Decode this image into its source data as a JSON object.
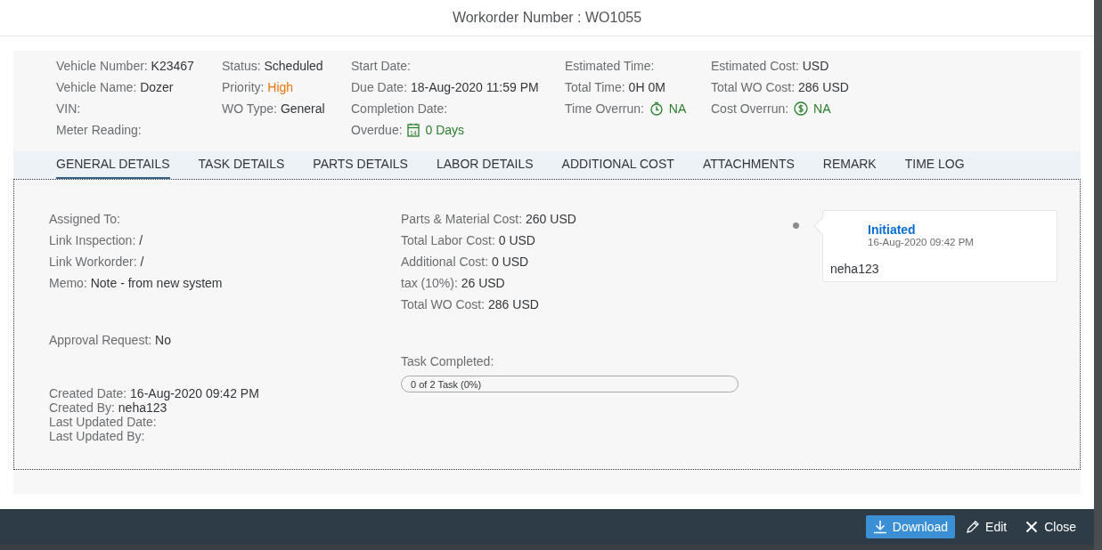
{
  "dialog": {
    "title": "Workorder Number : WO1055"
  },
  "header_columns": [
    {
      "fields": [
        {
          "label": "Vehicle Number:",
          "value": "K23467",
          "kind": "plain"
        },
        {
          "label": "Vehicle Name:",
          "value": "Dozer",
          "kind": "plain"
        },
        {
          "label": "VIN:",
          "kind": "plain"
        },
        {
          "label": "Meter Reading:",
          "kind": "plain"
        }
      ]
    },
    {
      "fields": [
        {
          "label": "Status:",
          "value": "Scheduled",
          "kind": "plain"
        },
        {
          "label": "Priority:",
          "value": "High",
          "kind": "plain",
          "color": "#e9730c"
        },
        {
          "label": "WO Type:",
          "value": "General",
          "kind": "plain"
        }
      ]
    },
    {
      "fields": [
        {
          "label": "Start Date:",
          "kind": "plain"
        },
        {
          "label": "Due Date:",
          "value": "18-Aug-2020 11:59 PM",
          "kind": "plain"
        },
        {
          "label": "Completion Date:",
          "kind": "plain"
        },
        {
          "label": "Overdue:",
          "value": "0 Days",
          "kind": "calendar",
          "color": "#2b7d2b",
          "icon_text": "14"
        }
      ]
    },
    {
      "fields": [
        {
          "label": "Estimated Time:",
          "kind": "plain"
        },
        {
          "label": "Total Time:",
          "value": "0H 0M",
          "kind": "plain"
        },
        {
          "label": "Time Overrun:",
          "value": "NA",
          "kind": "stopwatch",
          "color": "#2b7d2b"
        }
      ]
    },
    {
      "fields": [
        {
          "label": "Estimated Cost:",
          "value": "USD",
          "kind": "plain"
        },
        {
          "label": "Total WO Cost:",
          "value": "286 USD",
          "kind": "plain"
        },
        {
          "label": "Cost Overrun:",
          "value": "NA",
          "kind": "coin",
          "color": "#2b7d2b"
        }
      ]
    }
  ],
  "tabs": [
    {
      "label": "GENERAL DETAILS",
      "selected": true
    },
    {
      "label": "TASK DETAILS",
      "selected": false
    },
    {
      "label": "PARTS DETAILS",
      "selected": false
    },
    {
      "label": "LABOR DETAILS",
      "selected": false
    },
    {
      "label": "ADDITIONAL COST",
      "selected": false
    },
    {
      "label": "ATTACHMENTS",
      "selected": false
    },
    {
      "label": "REMARK",
      "selected": false
    },
    {
      "label": "TIME LOG",
      "selected": false
    }
  ],
  "general_left": [
    {
      "kind": "spaced",
      "fields": [
        {
          "label": "Assigned To:"
        },
        {
          "label": "Link Inspection:",
          "value": "/"
        },
        {
          "label": "Link Workorder:",
          "value": "/"
        },
        {
          "label": "Memo:",
          "value": "Note - from new system"
        }
      ]
    },
    {
      "kind": "spaced",
      "fields": [
        {
          "label": "Approval Request:",
          "value": "No"
        }
      ]
    },
    {
      "kind": "tight",
      "fields": [
        {
          "label": "Created Date:",
          "value": "16-Aug-2020 09:42 PM"
        },
        {
          "label": "Created By:",
          "value": "neha123"
        },
        {
          "label": "Last Updated Date:"
        },
        {
          "label": "Last Updated By:"
        }
      ]
    }
  ],
  "general_middle": [
    {
      "label": "Parts & Material Cost:",
      "value": "260 USD"
    },
    {
      "label": "Total Labor Cost:",
      "value": "0 USD"
    },
    {
      "label": "Additional Cost:",
      "value": "0 USD"
    },
    {
      "label": "tax (10%):",
      "value": "26 USD"
    },
    {
      "label": "Total WO Cost:",
      "value": "286 USD"
    }
  ],
  "task_progress": {
    "label": "Task Completed:",
    "text": "0 of 2 Task (0%)",
    "level": 0
  },
  "timeline": [
    {
      "status": "Initiated",
      "time": "16-Aug-2020 09:42 PM",
      "user": "neha123"
    }
  ],
  "footer_buttons": [
    {
      "label": "Download",
      "kind": "emphasized"
    },
    {
      "label": "Edit",
      "kind": "transparent"
    },
    {
      "label": "Close",
      "kind": "transparent"
    }
  ]
}
